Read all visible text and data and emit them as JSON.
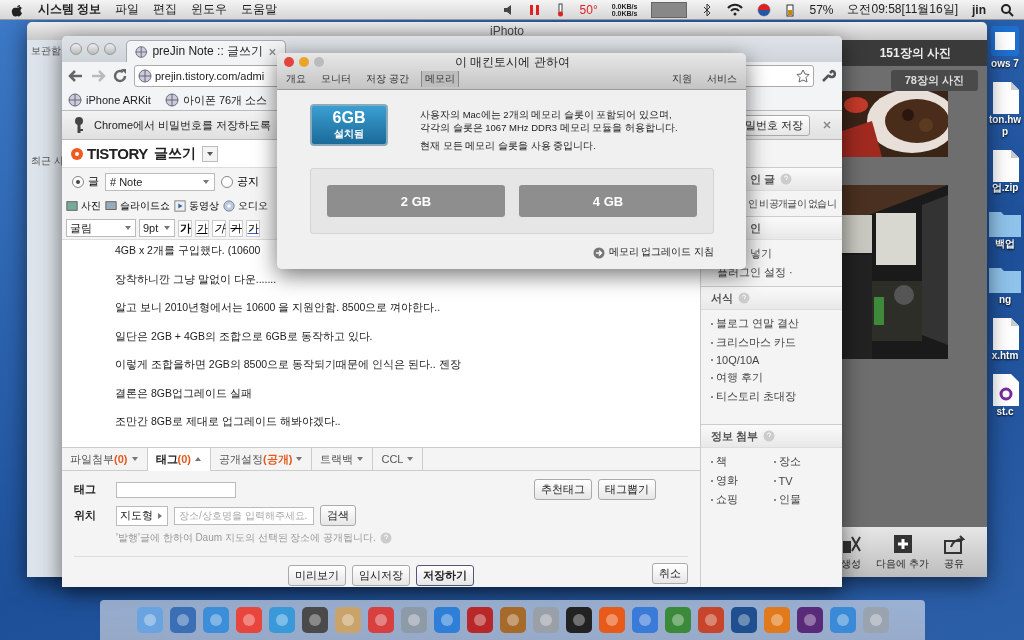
{
  "menubar": {
    "menus": [
      "시스템 정보",
      "파일",
      "편집",
      "윈도우",
      "도움말"
    ],
    "temperature": "50°",
    "net_rates": [
      "0.0KB/s",
      "0.0KB/s"
    ],
    "battery": "57%",
    "clock": "오전09:58[11월16일]",
    "user": "jin"
  },
  "desktop_icons": [
    {
      "kind": "app",
      "lines": [
        "ows 7"
      ]
    },
    {
      "kind": "file",
      "lines": [
        "ton.hw",
        "p"
      ]
    },
    {
      "kind": "file",
      "lines": [
        "업.zip"
      ]
    },
    {
      "kind": "folder",
      "lines": [
        "백업"
      ]
    },
    {
      "kind": "folder",
      "lines": [
        "ng"
      ]
    },
    {
      "kind": "file",
      "lines": [
        "x.htm"
      ]
    },
    {
      "kind": "source",
      "lines": [
        "st.c"
      ]
    }
  ],
  "iphoto": {
    "title": "iPhoto",
    "sidebar_labels": [
      "보관함",
      "최근 사"
    ],
    "photo_count": "151장의 사진",
    "event_count": "78장의 사진",
    "photos": [
      {
        "kind": "picture"
      },
      {
        "kind": "picture"
      }
    ],
    "toolbar": [
      "생성",
      "다음에 추가",
      "공유"
    ]
  },
  "chrome": {
    "tab_title": "preJin Note :: 글쓰기",
    "url": "prejin.tistory.com/admi",
    "bookmarks": [
      "iPhone ARKit",
      "아이폰 76개 소스"
    ],
    "password_bar": {
      "message": "Chrome에서 비밀번호를 저장하도록",
      "save_button": "밀번호 저장"
    }
  },
  "tistory": {
    "logo": "TISTORY",
    "title": "글쓰기",
    "post_types": [
      {
        "label": "글",
        "selected": true
      },
      {
        "label": "공지",
        "selected": false
      }
    ],
    "category": "# Note",
    "media": [
      "사진",
      "슬라이드쇼",
      "동영상",
      "오디오"
    ],
    "font": "굴림",
    "size": "9pt",
    "format_buttons": [
      {
        "kind": "bold",
        "label": "가"
      },
      {
        "kind": "underline",
        "label": "가"
      },
      {
        "kind": "italic",
        "label": "가"
      },
      {
        "kind": "strike",
        "label": "가"
      },
      {
        "kind": "color",
        "label": "가"
      }
    ],
    "paragraphs": [
      "4GB x 2개를 구입했다. (10600",
      "장착하니깐 그냥 말없이 다운.......",
      "알고 보니 2010년형에서는 10600 을 지원안함. 8500으로 껴야한다..",
      "일단은 2GB + 4GB의 조합으로 6GB로 동작하고 있다.",
      "이렇게 조합을하면 2GB의 8500으로 동작되기때문에 인식은 된다.. 젠장",
      "결론은 8GB업그레이드 실패",
      "조만간 8GB로 제대로 업그레이드 해봐야겠다.."
    ],
    "bottom_tabs": [
      {
        "label": "파일첨부",
        "count": "(0)",
        "selected": false
      },
      {
        "label": "태그",
        "count": "(0)",
        "selected": true
      },
      {
        "label": "공개설정",
        "count": "(공개)",
        "selected": false
      },
      {
        "label": "트랙백",
        "selected": false
      },
      {
        "label": "CCL",
        "selected": false
      }
    ],
    "tag_label": "태그",
    "location_label": "위치",
    "map_type": "지도형",
    "place_placeholder": "장소/상호명을 입력해주세요.",
    "search_button": "검색",
    "location_note": "'발행'글에 한하여 Daum 지도의 선택된 장소에 공개됩니다.",
    "tag_buttons": [
      "추천태그",
      "태그뽑기"
    ],
    "actions": [
      {
        "label": "미리보기",
        "primary": false
      },
      {
        "label": "임시저장",
        "primary": false
      },
      {
        "label": "저장하기",
        "primary": true
      }
    ],
    "cancel": "취소",
    "sidebar": {
      "drafts_heading": "인 글",
      "drafts_text": "인 비공개글이 없습니",
      "plugin_heading": "인",
      "plugin_item": "넣기",
      "plugin_settings": "플러그인 설정 ·",
      "format_heading": "서식",
      "format_items": [
        "블로그 연말 결산",
        "크리스마스 카드",
        "10Q/10A",
        "여행 후기",
        "티스토리 초대장"
      ],
      "info_heading": "정보 첨부",
      "info_items": [
        "책",
        "장소",
        "영화",
        "TV",
        "쇼핑",
        "인물"
      ]
    }
  },
  "about_mac": {
    "title": "이 매킨토시에 관하여",
    "tabs": [
      {
        "label": "개요",
        "selected": false
      },
      {
        "label": "모니터",
        "selected": false
      },
      {
        "label": "저장 공간",
        "selected": false
      },
      {
        "label": "메모리",
        "selected": true
      }
    ],
    "links": [
      "지원",
      "서비스"
    ],
    "installed": {
      "amount": "6GB",
      "caption": "설치됨"
    },
    "description": [
      "사용자의 Mac에는 2개의 메모리 슬롯이 포함되어 있으며,",
      "각각의 슬롯은 1067 MHz DDR3 메모리 모듈을 허용합니다."
    ],
    "status": "현재 모든 메모리 슬롯을 사용 중입니다.",
    "slots": [
      "2 GB",
      "4 GB"
    ],
    "upgrade_link": "메모리 업그레이드 지침"
  }
}
